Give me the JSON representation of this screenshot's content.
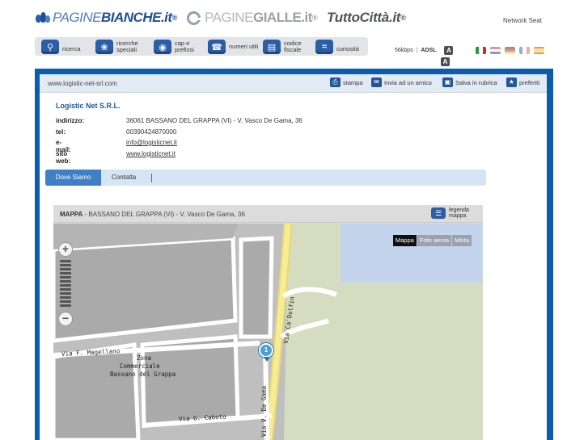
{
  "header": {
    "brand_pb": {
      "bold1": "PAGINE",
      "bold2": "BIANCHE",
      "tld": ".it",
      "reg": "®"
    },
    "brand_pg": {
      "light": "PAGINE",
      "bold": "GIALLE",
      "tld": ".it",
      "reg": "®"
    },
    "brand_tc": {
      "name": "TuttoCittà",
      "tld": ".it",
      "reg": "®"
    },
    "network_link": "Network Seat"
  },
  "nav": {
    "items": [
      {
        "label": "ricerca",
        "icon": "search-icon"
      },
      {
        "label": "ricerche speciali",
        "icon": "clover-icon"
      },
      {
        "label": "cap e prefissi",
        "icon": "globe-icon"
      },
      {
        "label": "numeri utili",
        "icon": "phone-icon"
      },
      {
        "label": "codice fiscale",
        "icon": "card-icon"
      },
      {
        "label": "curiosità",
        "icon": "spring-icon"
      }
    ],
    "speed": {
      "low": "56kbps",
      "high": "ADSL",
      "text_size_a": "A",
      "text_size_b": "A"
    },
    "flags": [
      "it",
      "en",
      "de",
      "fr",
      "es"
    ]
  },
  "actions": {
    "url": "www.logistic-net-srl.com",
    "print": "stampa",
    "send": "Invia ad un amico",
    "save": "Salva in rubrica",
    "favorites": "preferiti"
  },
  "company": {
    "name": "Logistic Net S.R.L.",
    "rows": [
      {
        "key": "indirizzo:",
        "value": "36061 BASSANO DEL GRAPPA (VI) - V. Vasco De Gama, 36"
      },
      {
        "key": "tel:",
        "value": "00390424870000"
      },
      {
        "key": "e-mail:",
        "value": "info@logisticnet.it"
      },
      {
        "key": "sito web:",
        "value": "www.logisticnet.it"
      }
    ]
  },
  "tabs": {
    "active": "Dove Siamo",
    "other": "Contatta"
  },
  "map": {
    "title_bold": "MAPPA",
    "title_rest": " - BASSANO DEL GRAPPA (VI) - V. Vasco De Gama, 36",
    "legend": "legenda mappa",
    "types": [
      "Mappa",
      "Foto aerea",
      "Mista"
    ],
    "zoom_in": "+",
    "zoom_out": "−",
    "pin": "1",
    "labels": {
      "street1": "Via F. Magellano",
      "zone1": "Zona",
      "zone2": "Commerciale",
      "zone3": "Bassano del Grappa",
      "street2": "Via G. Caboto",
      "street3": "Via V. De Gama",
      "street4": "Via Ca'Dolfin"
    }
  },
  "colors": {
    "accent_blue": "#0a5cad",
    "link_blue": "#1f5799",
    "tab_active": "#3e7fc6"
  }
}
